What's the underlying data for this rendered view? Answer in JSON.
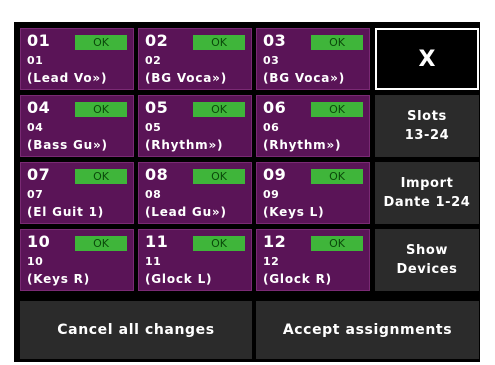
{
  "status_ok": "OK",
  "slots": [
    {
      "num": "01",
      "sub": "01",
      "name": "(Lead Vo»)"
    },
    {
      "num": "02",
      "sub": "02",
      "name": "(BG Voca»)"
    },
    {
      "num": "03",
      "sub": "03",
      "name": "(BG Voca»)"
    },
    {
      "num": "04",
      "sub": "04",
      "name": "(Bass Gu»)"
    },
    {
      "num": "05",
      "sub": "05",
      "name": "(Rhythm»)"
    },
    {
      "num": "06",
      "sub": "06",
      "name": "(Rhythm»)"
    },
    {
      "num": "07",
      "sub": "07",
      "name": "(El Guit 1)"
    },
    {
      "num": "08",
      "sub": "08",
      "name": "(Lead Gu»)"
    },
    {
      "num": "09",
      "sub": "09",
      "name": "(Keys L)"
    },
    {
      "num": "10",
      "sub": "10",
      "name": "(Keys R)"
    },
    {
      "num": "11",
      "sub": "11",
      "name": "(Glock L)"
    },
    {
      "num": "12",
      "sub": "12",
      "name": "(Glock R)"
    }
  ],
  "side_buttons": {
    "close_label": "X",
    "slots_label": "Slots\n13-24",
    "import_label": "Import\nDante 1-24",
    "devices_label": "Show\nDevices"
  },
  "bottom_buttons": {
    "cancel_label": "Cancel all changes",
    "accept_label": "Accept assignments"
  },
  "colors": {
    "slot_bg": "#5a1457",
    "ok_green": "#3fb53a",
    "button_gray": "#2b2b2b",
    "screen_bg": "#000000"
  }
}
